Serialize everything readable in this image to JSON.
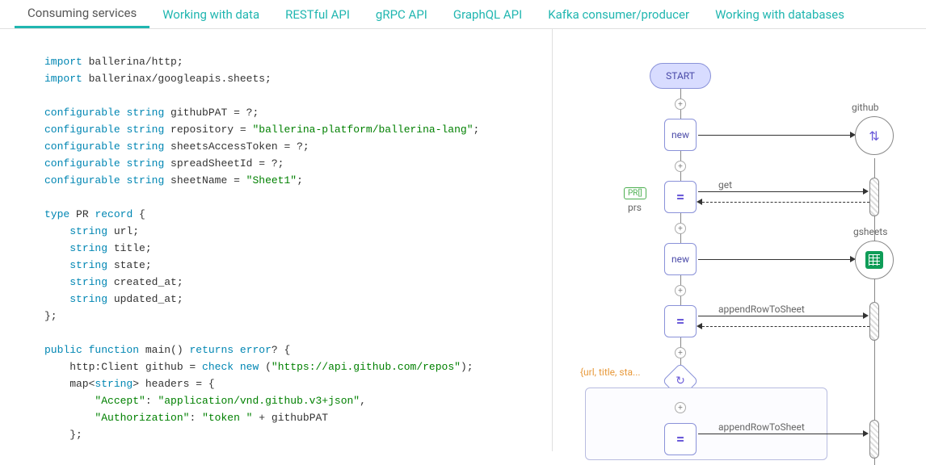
{
  "tabs": [
    "Consuming services",
    "Working with data",
    "RESTful API",
    "gRPC API",
    "GraphQL API",
    "Kafka consumer/producer",
    "Working with databases"
  ],
  "code": {
    "l1a": "import",
    "l1b": " ballerina/http;",
    "l2a": "import",
    "l2b": " ballerinax/googleapis.sheets;",
    "l3a": "configurable",
    "l3b": "string",
    "l3c": " githubPAT = ?;",
    "l4a": "configurable",
    "l4b": "string",
    "l4c": " repository = ",
    "l4d": "\"ballerina-platform/ballerina-lang\"",
    "l4e": ";",
    "l5a": "configurable",
    "l5b": "string",
    "l5c": " sheetsAccessToken = ?;",
    "l6a": "configurable",
    "l6b": "string",
    "l6c": " spreadSheetId = ?;",
    "l7a": "configurable",
    "l7b": "string",
    "l7c": " sheetName = ",
    "l7d": "\"Sheet1\"",
    "l7e": ";",
    "l8a": "type",
    "l8b": " PR ",
    "l8c": "record",
    "l8d": " {",
    "l9a": "string",
    "l9b": " url;",
    "l10a": "string",
    "l10b": " title;",
    "l11a": "string",
    "l11b": " state;",
    "l12a": "string",
    "l12b": " created_at;",
    "l13a": "string",
    "l13b": " updated_at;",
    "l14": "};",
    "l15a": "public",
    "l15b": "function",
    "l15c": " main() ",
    "l15d": "returns",
    "l15e": "error",
    "l15f": "? {",
    "l16a": "    http:Client github = ",
    "l16b": "check",
    "l16c": "new",
    "l16d": " (",
    "l16e": "\"https://api.github.com/repos\"",
    "l16f": ");",
    "l17a": "    map<",
    "l17b": "string",
    "l17c": "> headers = {",
    "l18a": "\"Accept\"",
    "l18b": ": ",
    "l18c": "\"application/vnd.github.v3+json\"",
    "l18d": ",",
    "l19a": "\"Authorization\"",
    "l19b": ": ",
    "l19c": "\"token \"",
    "l19d": " + githubPAT",
    "l20": "    };"
  },
  "diagram": {
    "start": "START",
    "new1": "new",
    "new2": "new",
    "eq": "=",
    "github": "github",
    "gsheets": "gsheets",
    "get": "get",
    "append": "appendRowToSheet",
    "append2": "appendRowToSheet",
    "prs": "prs",
    "prtag": "PR[]",
    "foreach": "{url, title, sta..."
  }
}
